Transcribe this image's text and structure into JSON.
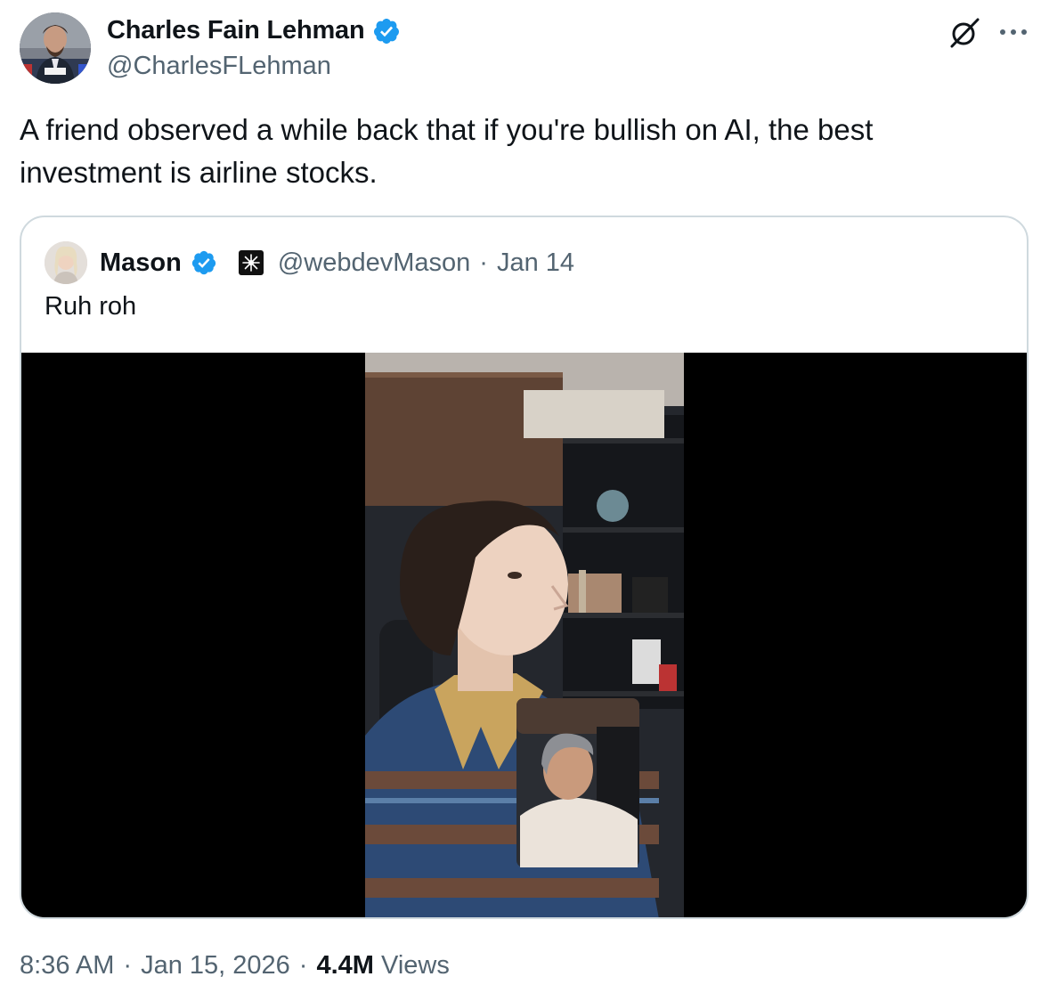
{
  "author": {
    "name": "Charles Fain Lehman",
    "handle": "@CharlesFLehman",
    "verified": true,
    "avatar_caption": "Mr. Charles"
  },
  "tweet": {
    "text": "A friend observed a while back that if you're bullish on AI, the best\ninvestment is airline stocks."
  },
  "quoted": {
    "name": "Mason",
    "handle": "@webdevMason",
    "separator": "·",
    "date": "Jan 14",
    "text": "Ruh roh",
    "verified": true
  },
  "meta": {
    "time": "8:36 AM",
    "sep1": "·",
    "date": "Jan 15, 2026",
    "sep2": "·",
    "views_count": "4.4M",
    "views_label": "Views"
  },
  "icons": {
    "grok": "grok-icon",
    "more": "more-icon",
    "verified": "verified-badge-icon",
    "affiliate": "affiliate-badge-icon"
  },
  "colors": {
    "verified_blue": "#1d9bf0",
    "text_primary": "#0f1419",
    "text_secondary": "#536471",
    "border": "#cfd9de"
  }
}
